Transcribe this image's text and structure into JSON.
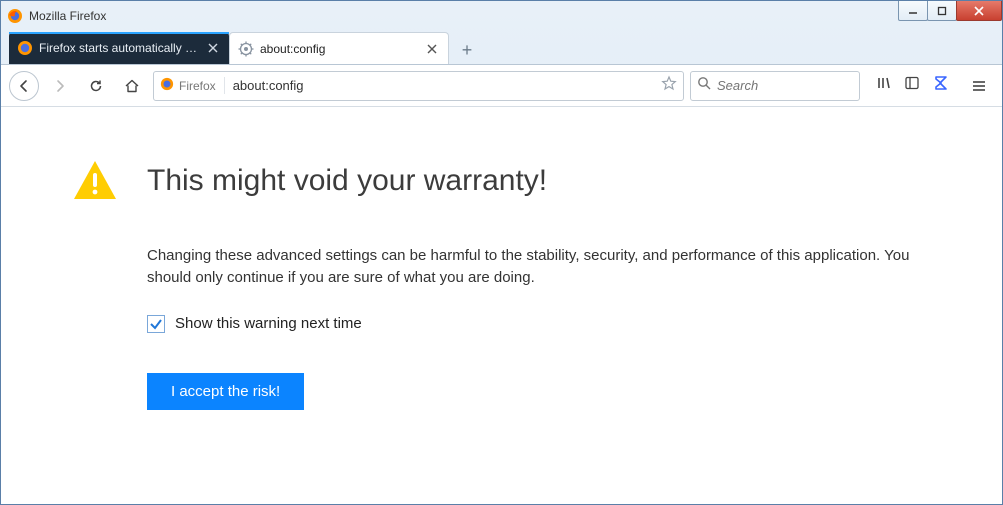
{
  "window": {
    "title": "Mozilla Firefox"
  },
  "tabs": [
    {
      "label": "Firefox starts automatically when",
      "active": false
    },
    {
      "label": "about:config",
      "active": true
    }
  ],
  "toolbar": {
    "identity_label": "Firefox",
    "url_value": "about:config",
    "search_placeholder": "Search"
  },
  "page": {
    "heading": "This might void your warranty!",
    "body": "Changing these advanced settings can be harmful to the stability, security, and performance of this application. You should only continue if you are sure of what you are doing.",
    "checkbox_label": "Show this warning next time",
    "checkbox_checked": true,
    "accept_button": "I accept the risk!"
  }
}
